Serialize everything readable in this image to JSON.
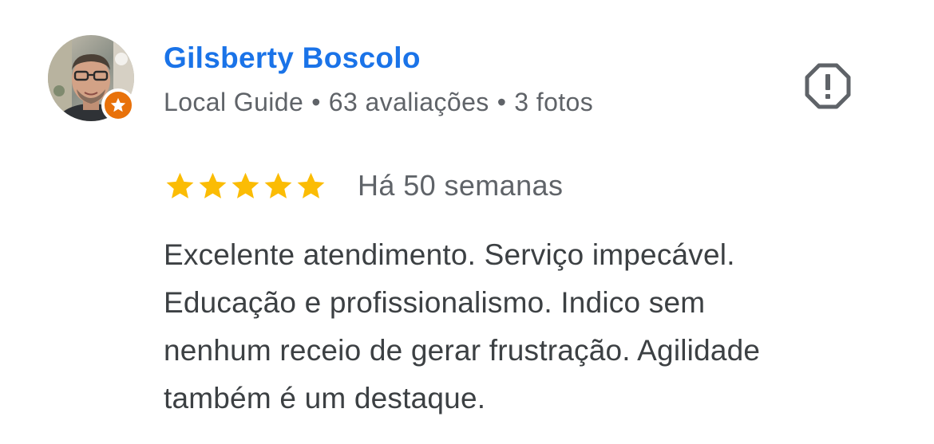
{
  "review": {
    "author": {
      "name": "Gilsberty Boscolo",
      "avatar_icon": "user-photo",
      "badge_icon": "local-guide-star-icon",
      "badge_color": "#e8710a",
      "level": "Local Guide",
      "reviews_count": "63 avaliações",
      "photos_count": "3 fotos",
      "separator": "•"
    },
    "report_icon": "report-octagon-icon",
    "rating": {
      "stars": 5,
      "max_stars": 5,
      "star_color": "#fbbc04"
    },
    "time_ago": "Há 50 semanas",
    "text_lines": [
      "Excelente atendimento. Serviço impecável.",
      "Educação e profissionalismo. Indico sem",
      "nenhum receio de gerar frustração. Agilidade",
      "também é um destaque."
    ]
  },
  "colors": {
    "name": "#1a73e8",
    "meta": "#5f6368",
    "body_text": "#3c4043",
    "icon": "#5f6368"
  }
}
